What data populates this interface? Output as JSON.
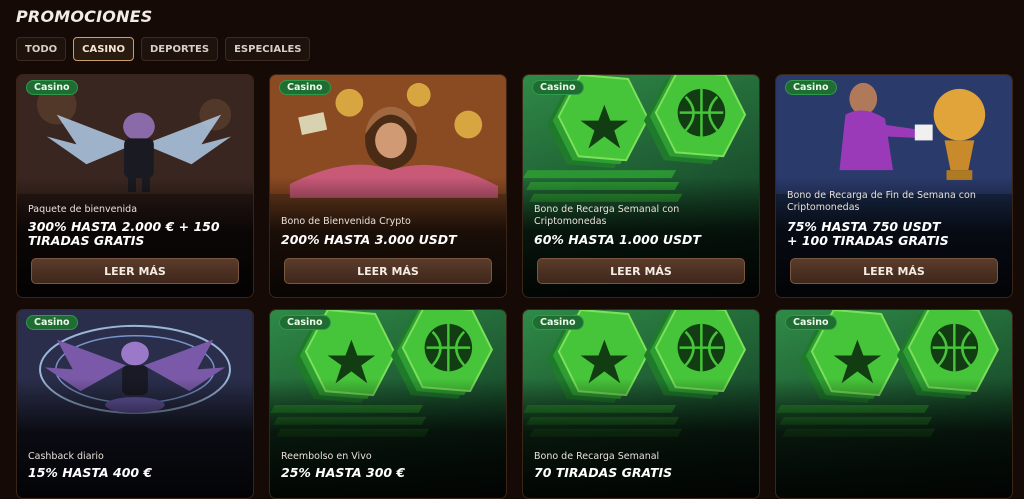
{
  "page": {
    "title": "PROMOCIONES"
  },
  "tabs": [
    {
      "label": "TODO",
      "active": false
    },
    {
      "label": "CASINO",
      "active": true
    },
    {
      "label": "DEPORTES",
      "active": false
    },
    {
      "label": "ESPECIALES",
      "active": false
    }
  ],
  "colors": {
    "badge_green": "#1f6d33",
    "button_brown": "#4a2f20",
    "active_tab_border": "#c9a169",
    "background": "#150a06"
  },
  "cards": [
    {
      "badge": "Casino",
      "subtitle": "Paquete de bienvenida",
      "headline": [
        "300% HASTA 2.000 € + 150",
        "TIRADAS GRATIS"
      ],
      "button": "LEER MÁS",
      "art": "dragon-mascot"
    },
    {
      "badge": "Casino",
      "subtitle": "Bono de Bienvenida Crypto",
      "headline": [
        "200% HASTA 3.000 USDT"
      ],
      "button": "LEER MÁS",
      "art": "man-with-crypto-coins"
    },
    {
      "badge": "Casino",
      "subtitle": "Bono de Recarga Semanal con Criptomonedas",
      "headline": [
        "60% HASTA 1.000 USDT"
      ],
      "button": "LEER MÁS",
      "art": "green-chips"
    },
    {
      "badge": "Casino",
      "subtitle": "Bono de Recarga de Fin de Semana con Criptomonedas",
      "headline": [
        "75% HASTA 750 USDT",
        "+ 100 TIRADAS GRATIS"
      ],
      "button": "LEER MÁS",
      "art": "man-polishing-trophy"
    },
    {
      "badge": "Casino",
      "subtitle": "Cashback diario",
      "headline": [
        "15% HASTA 400 €"
      ],
      "art": "dragon-meditating"
    },
    {
      "badge": "Casino",
      "subtitle": "Reembolso en Vivo",
      "headline": [
        "25% HASTA 300 €"
      ],
      "art": "green-chips"
    },
    {
      "badge": "Casino",
      "subtitle": "Bono de Recarga Semanal",
      "headline": [
        "70 TIRADAS GRATIS"
      ],
      "art": "green-chips"
    },
    {
      "badge": "Casino",
      "subtitle": "",
      "headline": [],
      "art": "green-chips"
    }
  ]
}
